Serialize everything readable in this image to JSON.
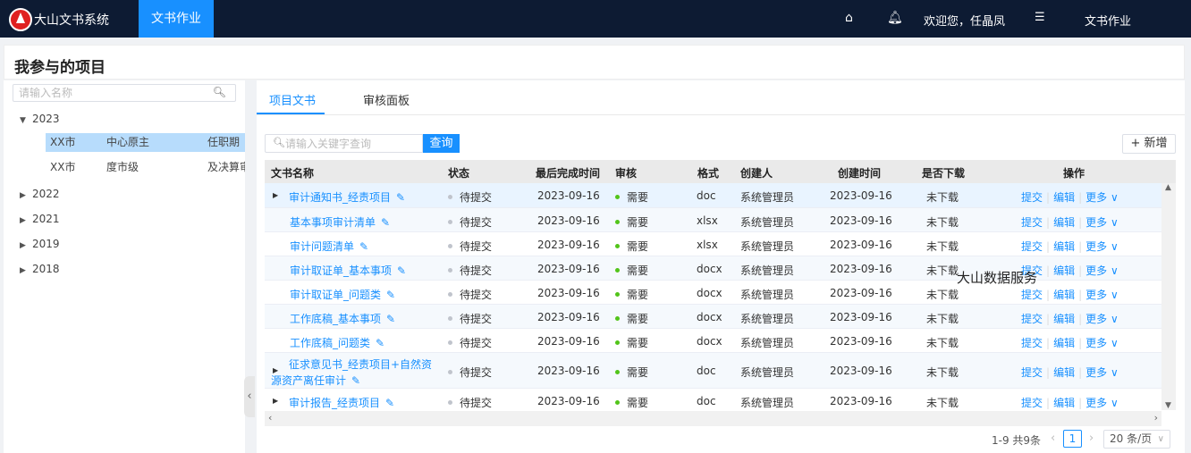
{
  "app": {
    "title": "大山文书系统",
    "active_tab": "文书作业",
    "welcome": "欢迎您，任晶凤",
    "right_menu": "文书作业"
  },
  "icons": {
    "home": "home-icon",
    "bell": "bell-icon",
    "menu": "list-icon",
    "search": "search-icon",
    "pencil": "edit-pencil-icon"
  },
  "page": {
    "title": "我参与的项目"
  },
  "tree": {
    "search_placeholder": "请输入名称",
    "years": [
      "2023",
      "2022",
      "2021",
      "2019",
      "2018"
    ],
    "children_2023": [
      {
        "c1": "XX市",
        "c2": "中心原主",
        "c3": "任职期"
      },
      {
        "c1": "XX市",
        "c2": "度市级",
        "c3": "及决算审"
      }
    ]
  },
  "tabs": [
    "项目文书",
    "审核面板"
  ],
  "toolbar": {
    "search_placeholder": "请输入关键字查询",
    "search_label": "查询",
    "add_label": "+ 新增"
  },
  "table": {
    "columns": [
      "文书名称",
      "状态",
      "最后完成时间",
      "审核",
      "格式",
      "创建人",
      "创建时间",
      "是否下载",
      "操作"
    ],
    "rows": [
      {
        "name": "审计通知书_经责项目",
        "status": "待提交",
        "finish": "2023-09-16",
        "review": "需要",
        "format": "doc",
        "creator": "系统管理员",
        "created": "2023-09-16",
        "download": "未下载",
        "expandable": true
      },
      {
        "name": "基本事项审计清单",
        "status": "待提交",
        "finish": "2023-09-16",
        "review": "需要",
        "format": "xlsx",
        "creator": "系统管理员",
        "created": "2023-09-16",
        "download": "未下载",
        "expandable": false
      },
      {
        "name": "审计问题清单",
        "status": "待提交",
        "finish": "2023-09-16",
        "review": "需要",
        "format": "xlsx",
        "creator": "系统管理员",
        "created": "2023-09-16",
        "download": "未下载",
        "expandable": false
      },
      {
        "name": "审计取证单_基本事项",
        "status": "待提交",
        "finish": "2023-09-16",
        "review": "需要",
        "format": "docx",
        "creator": "系统管理员",
        "created": "2023-09-16",
        "download": "未下载",
        "expandable": false
      },
      {
        "name": "审计取证单_问题类",
        "status": "待提交",
        "finish": "2023-09-16",
        "review": "需要",
        "format": "docx",
        "creator": "系统管理员",
        "created": "2023-09-16",
        "download": "未下载",
        "expandable": false
      },
      {
        "name": "工作底稿_基本事项",
        "status": "待提交",
        "finish": "2023-09-16",
        "review": "需要",
        "format": "docx",
        "creator": "系统管理员",
        "created": "2023-09-16",
        "download": "未下载",
        "expandable": false
      },
      {
        "name": "工作底稿_问题类",
        "status": "待提交",
        "finish": "2023-09-16",
        "review": "需要",
        "format": "docx",
        "creator": "系统管理员",
        "created": "2023-09-16",
        "download": "未下载",
        "expandable": false
      },
      {
        "name": "征求意见书_经责项目+自然资",
        "name_line2": "源资产离任审计",
        "status": "待提交",
        "finish": "2023-09-16",
        "review": "需要",
        "format": "doc",
        "creator": "系统管理员",
        "created": "2023-09-16",
        "download": "未下载",
        "expandable": true
      },
      {
        "name": "审计报告_经责项目",
        "status": "待提交",
        "finish": "2023-09-16",
        "review": "需要",
        "format": "doc",
        "creator": "系统管理员",
        "created": "2023-09-16",
        "download": "未下载",
        "expandable": true
      }
    ],
    "actions": {
      "submit": "提交",
      "edit": "编辑",
      "more": "更多"
    }
  },
  "watermark": "大山数据服务",
  "pagination": {
    "total": "1-9 共9条",
    "current": "1",
    "page_size": "20 条/页"
  }
}
